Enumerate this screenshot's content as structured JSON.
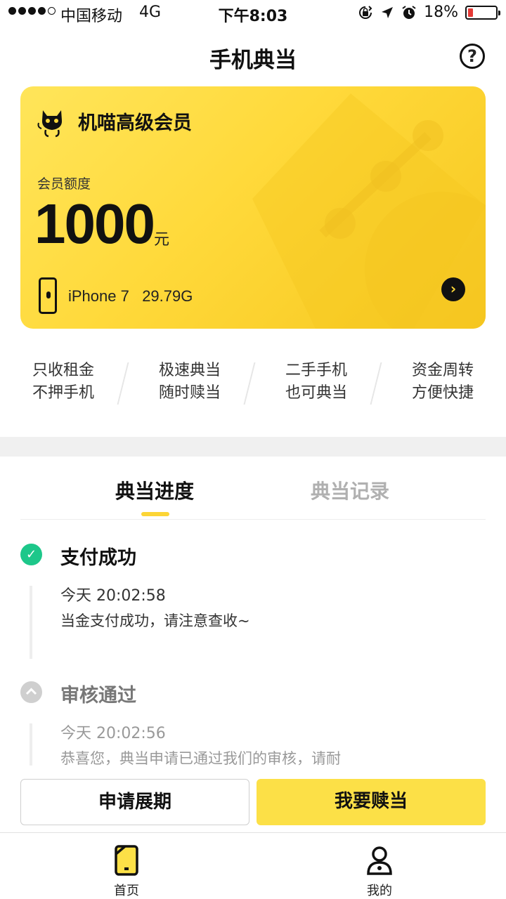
{
  "status_bar": {
    "carrier": "中国移动",
    "network": "4G",
    "time": "下午8:03",
    "battery": "18%",
    "battery_level": 0.18,
    "icons": [
      "orientation-lock-icon",
      "location-arrow-icon",
      "alarm-icon",
      "battery-icon"
    ]
  },
  "nav": {
    "title": "手机典当",
    "help_icon": "?"
  },
  "card": {
    "membership": "机喵高级会员",
    "quota_label": "会员额度",
    "amount": "1000",
    "unit": "元",
    "device": "iPhone 7   29.79G",
    "arrow": "›",
    "colors": {
      "card": "#ffd93a",
      "text": "#111111"
    }
  },
  "features": [
    {
      "line1": "只收租金",
      "line2": "不押手机"
    },
    {
      "line1": "极速典当",
      "line2": "随时赎当"
    },
    {
      "line1": "二手手机",
      "line2": "也可典当"
    },
    {
      "line1": "资金周转",
      "line2": "方便快捷"
    }
  ],
  "tabs": {
    "active": "典当进度",
    "inactive": "典当记录"
  },
  "timeline": [
    {
      "title": "支付成功",
      "time": "今天 20:02:58",
      "desc": "当金支付成功，请注意查收~",
      "status": "done"
    },
    {
      "title": "审核通过",
      "time": "今天 20:02:56",
      "desc": "恭喜您，典当申请已通过我们的审核，请耐",
      "status": "past"
    }
  ],
  "buttons": {
    "extend": "申请展期",
    "redeem": "我要赎当"
  },
  "tabbar": [
    {
      "label": "首页",
      "icon": "phone-home-icon",
      "active": true
    },
    {
      "label": "我的",
      "icon": "user-icon",
      "active": false
    }
  ],
  "colors": {
    "accent": "#fcd535",
    "success": "#1dc78a",
    "muted": "#b0b0b0"
  }
}
